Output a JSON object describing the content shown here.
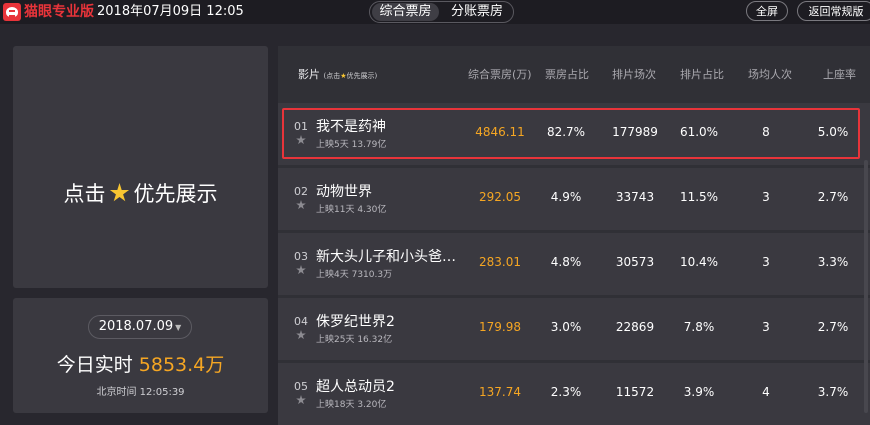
{
  "topbar": {
    "brand": "猫眼专业版",
    "datetime": "2018年07月09日 12:05",
    "tabs": [
      "综合票房",
      "分账票房"
    ],
    "fullscreen_label": "全屏",
    "back_label": "返回常规版"
  },
  "promo": {
    "before": "点击",
    "after": "优先展示"
  },
  "realtime": {
    "date": "2018.07.09",
    "label": "今日实时",
    "value": "5853.4",
    "unit": "万",
    "time": "北京时间 12:05:39"
  },
  "table": {
    "headers": {
      "movie": "影片",
      "movie_hint_pre": "(点击",
      "movie_hint_post": "优先展示)",
      "gross": "综合票房(万)",
      "gross_share": "票房占比",
      "shows": "排片场次",
      "show_share": "排片占比",
      "avg_people": "场均人次",
      "occupancy": "上座率"
    },
    "rows": [
      {
        "idx": "01",
        "name": "我不是药神",
        "sub": "上映5天  13.79亿",
        "gross": "4846.11",
        "gross_share": "82.7%",
        "shows": "177989",
        "show_share": "61.0%",
        "avg": "8",
        "occ": "5.0%"
      },
      {
        "idx": "02",
        "name": "动物世界",
        "sub": "上映11天  4.30亿",
        "gross": "292.05",
        "gross_share": "4.9%",
        "shows": "33743",
        "show_share": "11.5%",
        "avg": "3",
        "occ": "2.7%"
      },
      {
        "idx": "03",
        "name": "新大头儿子和小头爸…",
        "sub": "上映4天  7310.3万",
        "gross": "283.01",
        "gross_share": "4.8%",
        "shows": "30573",
        "show_share": "10.4%",
        "avg": "3",
        "occ": "3.3%"
      },
      {
        "idx": "04",
        "name": "侏罗纪世界2",
        "sub": "上映25天  16.32亿",
        "gross": "179.98",
        "gross_share": "3.0%",
        "shows": "22869",
        "show_share": "7.8%",
        "avg": "3",
        "occ": "2.7%"
      },
      {
        "idx": "05",
        "name": "超人总动员2",
        "sub": "上映18天  3.20亿",
        "gross": "137.74",
        "gross_share": "2.3%",
        "shows": "11572",
        "show_share": "3.9%",
        "avg": "4",
        "occ": "3.7%"
      }
    ]
  },
  "colors": {
    "accent": "#e8343a",
    "gross": "#f5a623",
    "star": "#f7c531",
    "background": "#28272e"
  }
}
